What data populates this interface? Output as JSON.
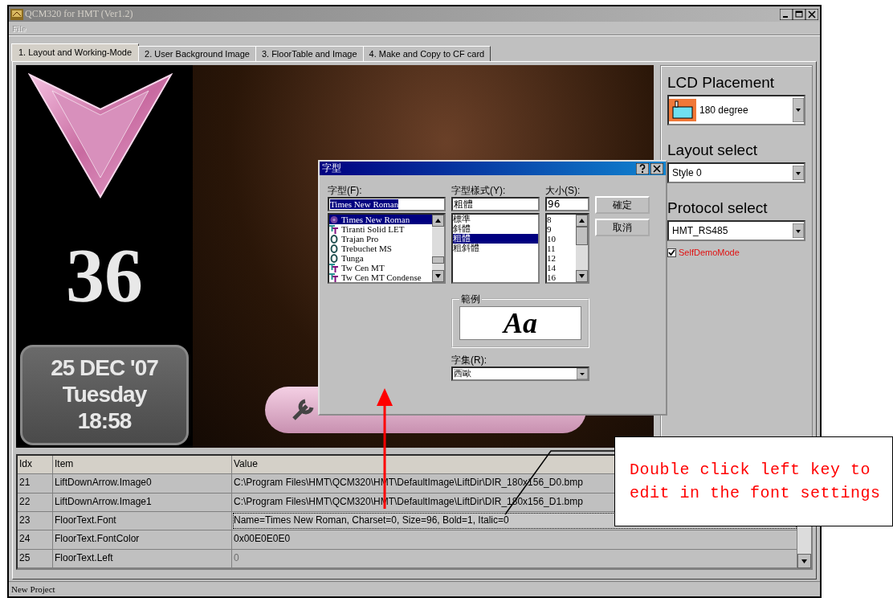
{
  "window": {
    "title": "QCM320 for HMT (Ver1.2)"
  },
  "menu": [
    {
      "label": "File",
      "disabled": true
    }
  ],
  "tabs": [
    {
      "label": "1. Layout and Working-Mode",
      "selected": true
    },
    {
      "label": "2. User Background Image",
      "selected": false
    },
    {
      "label": "3. FloorTable and Image",
      "selected": false
    },
    {
      "label": "4. Make and Copy to CF card",
      "selected": false
    }
  ],
  "preview": {
    "floor_number": "36",
    "date": "25 DEC '07",
    "weekday": "Tuesday",
    "time": "18:58"
  },
  "right_panel": {
    "lcd_placement": {
      "label": "LCD Placement",
      "value": "180 degree"
    },
    "layout_select": {
      "label": "Layout select",
      "value": "Style 0"
    },
    "protocol_select": {
      "label": "Protocol select",
      "value": "HMT_RS485"
    },
    "self_demo_mode": {
      "label": "SelfDemoMode",
      "checked": true
    }
  },
  "table": {
    "columns": [
      "Idx",
      "Item",
      "Value"
    ],
    "rows": [
      {
        "idx": "21",
        "item": "LiftDownArrow.Image0",
        "value": "C:\\Program Files\\HMT\\QCM320\\HMT\\DefaultImage\\LiftDir\\DIR_180x156_D0.bmp",
        "selected": false,
        "disabled": false
      },
      {
        "idx": "22",
        "item": "LiftDownArrow.Image1",
        "value": "C:\\Program Files\\HMT\\QCM320\\HMT\\DefaultImage\\LiftDir\\DIR_180x156_D1.bmp",
        "selected": false,
        "disabled": false
      },
      {
        "idx": "23",
        "item": "FloorText.Font",
        "value": "Name=Times New Roman, Charset=0, Size=96, Bold=1, Italic=0",
        "selected": true,
        "disabled": false
      },
      {
        "idx": "24",
        "item": "FloorText.FontColor",
        "value": "0x00E0E0E0",
        "selected": false,
        "disabled": false
      },
      {
        "idx": "25",
        "item": "FloorText.Left",
        "value": "0",
        "selected": false,
        "disabled": true
      }
    ]
  },
  "status_bar": "New Project",
  "font_dialog": {
    "title": "字型",
    "font_label": "字型(F):",
    "font_value": "Times New Roman",
    "fonts": [
      {
        "name": "Times New Roman",
        "kind": "symbol",
        "selected": true
      },
      {
        "name": "Tiranti Solid LET",
        "kind": "truetype",
        "selected": false
      },
      {
        "name": "Trajan Pro",
        "kind": "opentype",
        "selected": false
      },
      {
        "name": "Trebuchet MS",
        "kind": "opentype",
        "selected": false
      },
      {
        "name": "Tunga",
        "kind": "opentype",
        "selected": false
      },
      {
        "name": "Tw Cen MT",
        "kind": "truetype",
        "selected": false
      },
      {
        "name": "Tw Cen MT Condense",
        "kind": "truetype",
        "selected": false
      }
    ],
    "style_label": "字型樣式(Y):",
    "style_value": "粗體",
    "styles": [
      {
        "name": "標準",
        "selected": false
      },
      {
        "name": "斜體",
        "selected": false
      },
      {
        "name": "粗體",
        "selected": true
      },
      {
        "name": "粗斜體",
        "selected": false
      }
    ],
    "size_label": "大小(S):",
    "size_value": "96",
    "sizes": [
      "8",
      "9",
      "10",
      "11",
      "12",
      "14",
      "16"
    ],
    "buttons": [
      "確定",
      "取消"
    ],
    "sample_label": "範例",
    "sample_text": "Aa",
    "charset_label": "字集(R):",
    "charset_value": "西歐"
  },
  "callout": {
    "lines": [
      "Double click left key to",
      "edit in the font settings"
    ]
  }
}
